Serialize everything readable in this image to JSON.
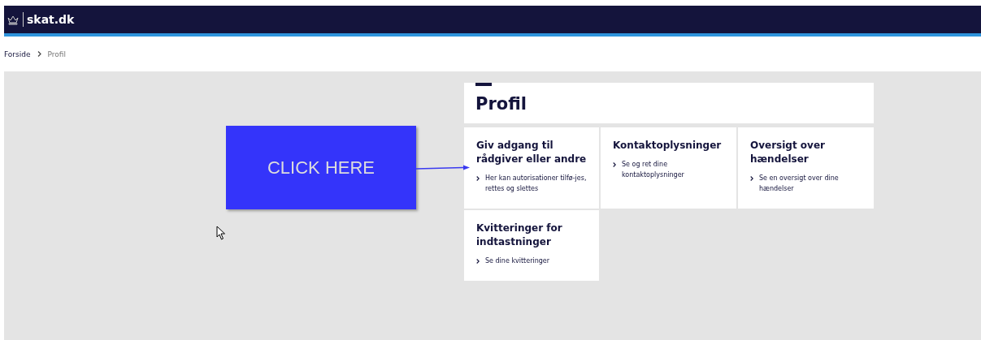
{
  "header": {
    "logo": "skat.dk"
  },
  "breadcrumb": [
    {
      "label": "Forside",
      "current": false
    },
    {
      "label": "Profil",
      "current": true
    }
  ],
  "page_title": "Profil",
  "cards": [
    {
      "title": "Giv adgang til rådgiver eller andre",
      "link": "Her kan autorisationer tilfø-jes, rettes og slettes"
    },
    {
      "title": "Kontaktoplysninger",
      "link": "Se og ret dine kontaktoplysninger"
    },
    {
      "title": "Oversigt over hændelser",
      "link": "Se en oversigt over dine hændelser"
    },
    {
      "title": "Kvitteringer for indtastninger",
      "link": "Se dine kvitteringer"
    }
  ],
  "callout": {
    "label": "CLICK HERE"
  }
}
